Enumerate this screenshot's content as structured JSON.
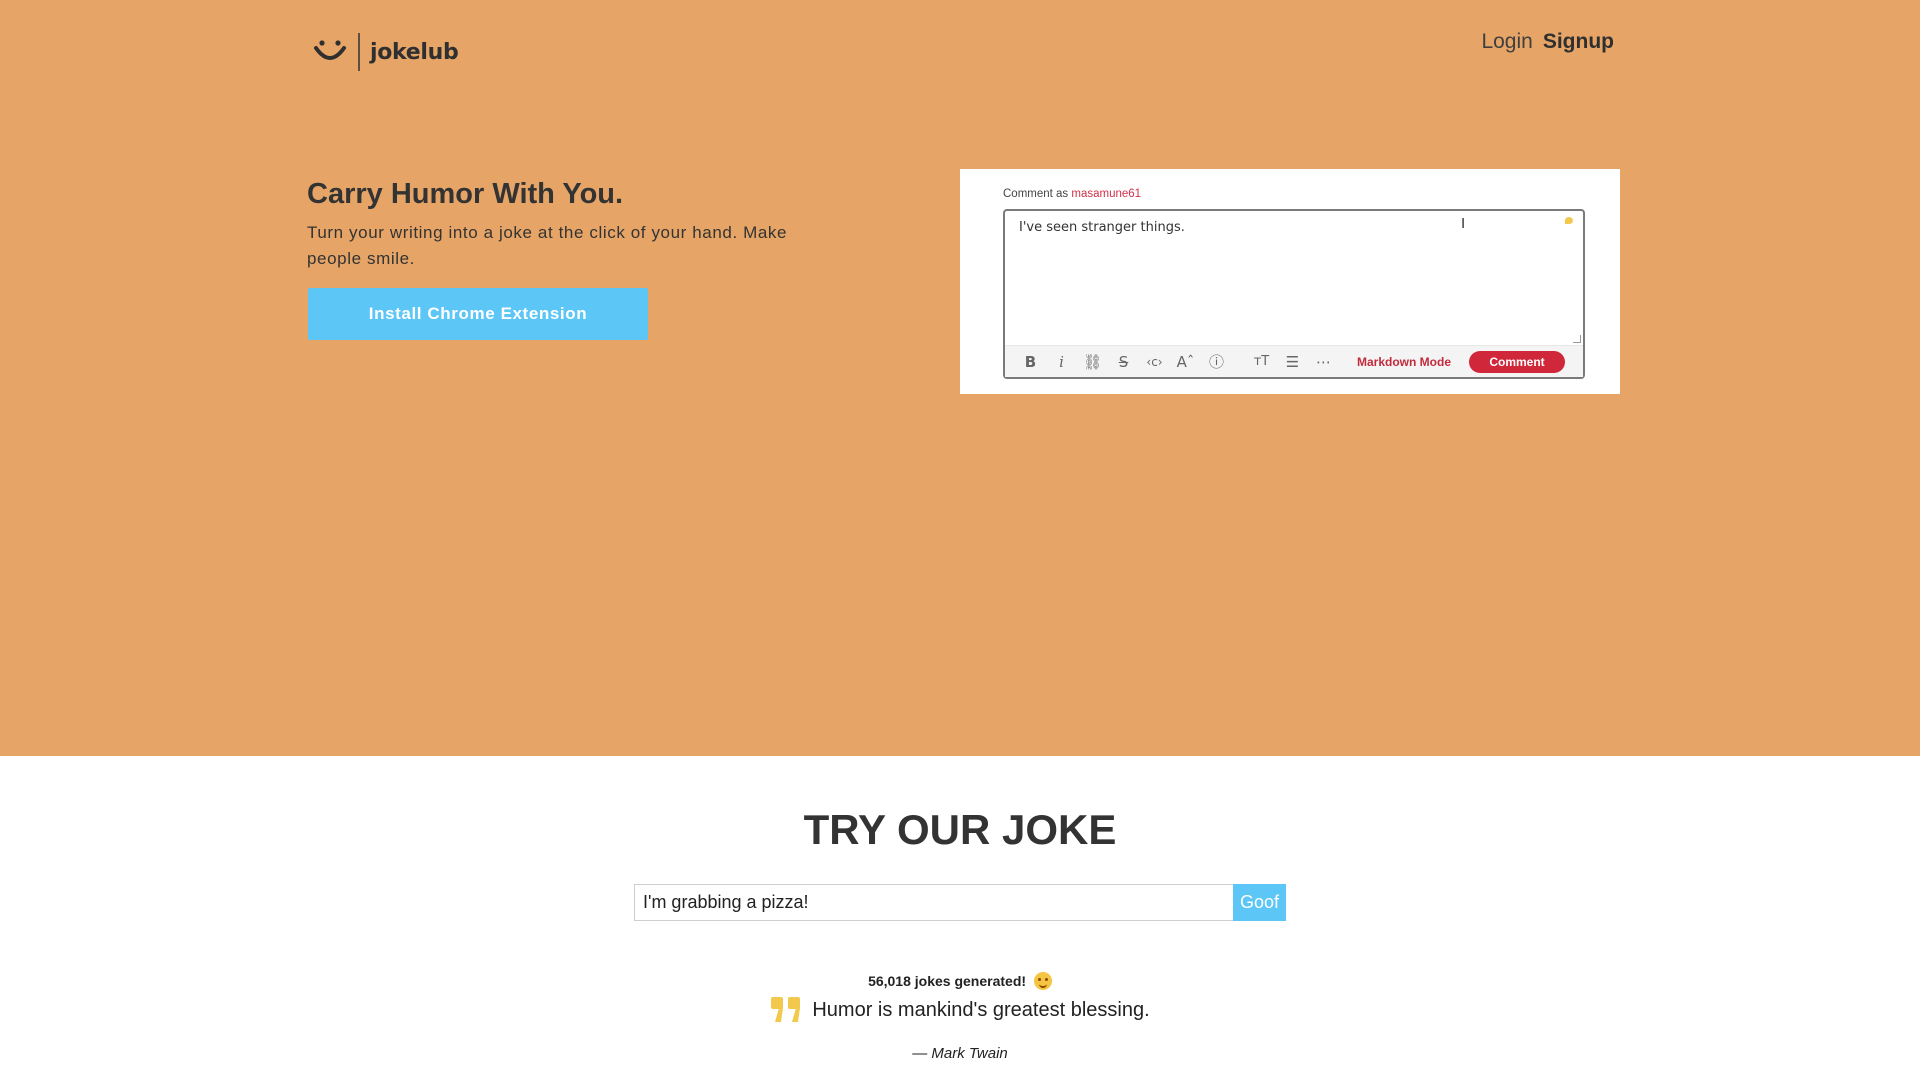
{
  "header": {
    "brand": "jokelub",
    "login_label": "Login",
    "signup_label": "Signup"
  },
  "hero": {
    "title": "Carry Humor With You.",
    "subtitle": "Turn your writing into a joke at the click of your hand. Make people smile.",
    "cta_label": "Install Chrome Extension"
  },
  "demo": {
    "comment_as_label": "Comment as",
    "username": "masamune61",
    "text": "I've seen stranger things.",
    "toolbar": {
      "icons": [
        "bold-icon",
        "italic-icon",
        "link-icon",
        "strikethrough-icon",
        "code-icon",
        "superscript-icon",
        "spoiler-icon",
        "heading-icon",
        "bulleted-list-icon",
        "more-icon"
      ],
      "markdown_mode_label": "Markdown Mode",
      "comment_label": "Comment"
    }
  },
  "try": {
    "title": "TRY OUR JOKE",
    "input_value": "I'm grabbing a pizza!",
    "submit_label": "Goof",
    "count_text": "56,018 jokes generated!"
  },
  "quote": {
    "text": "Humor is mankind's greatest blessing.",
    "author": "— Mark Twain"
  },
  "colors": {
    "hero_bg": "#e6a567",
    "accent_blue": "#5cc6f6",
    "quote_mark": "#f2c94c",
    "comment_red": "#d0273a"
  }
}
